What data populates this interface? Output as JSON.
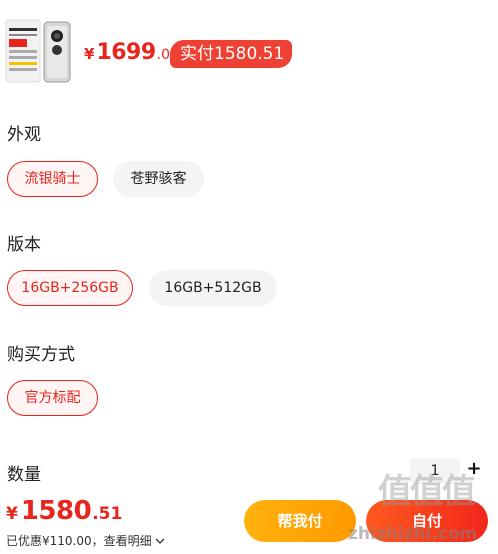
{
  "product": {
    "price_symbol": "¥",
    "price_integer": "1699",
    "price_decimal": ".00",
    "paid_badge": "实付1580.51"
  },
  "sections": {
    "appearance_title": "外观",
    "appearance_options": [
      "流银骑士",
      "苍野骇客"
    ],
    "version_title": "版本",
    "version_options": [
      "16GB+256GB",
      "16GB+512GB"
    ],
    "purchase_title": "购买方式",
    "purchase_options": [
      "官方标配"
    ],
    "quantity_title": "数量"
  },
  "quantity": {
    "value": "1",
    "plus": "+"
  },
  "footer": {
    "total_symbol": "¥",
    "total_integer": "1580",
    "total_decimal": ".51",
    "saving_text": "已优惠¥110.00，查看明细",
    "help_pay_label": "帮我付",
    "pay_label": "自付"
  },
  "watermark": {
    "mark": "值值值",
    "text": "zhizhizhi.com"
  },
  "colors": {
    "accent": "#e8251c",
    "orange": "#ff9a00"
  }
}
